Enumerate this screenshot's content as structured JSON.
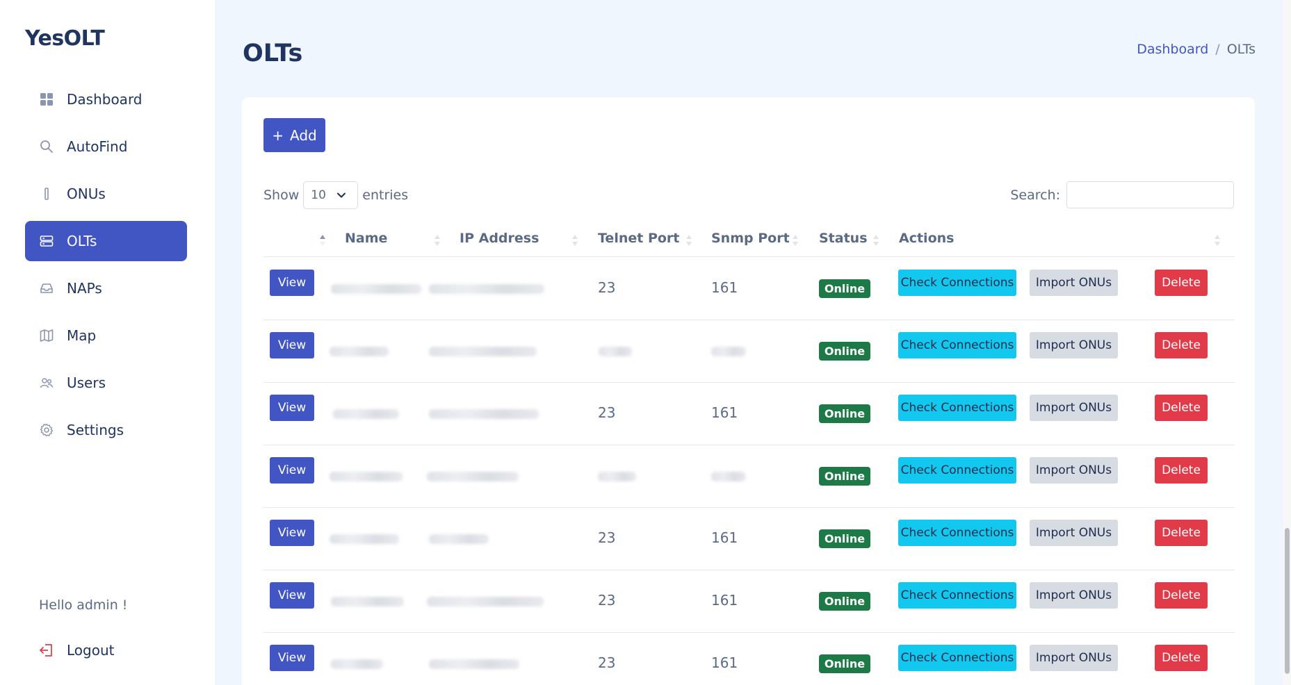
{
  "brand": "YesOLT",
  "nav": [
    {
      "label": "Dashboard",
      "icon": "grid-icon",
      "active": false
    },
    {
      "label": "AutoFind",
      "icon": "search-icon",
      "active": false
    },
    {
      "label": "ONUs",
      "icon": "device-icon",
      "active": false
    },
    {
      "label": "OLTs",
      "icon": "server-icon",
      "active": true
    },
    {
      "label": "NAPs",
      "icon": "inbox-icon",
      "active": false
    },
    {
      "label": "Map",
      "icon": "map-icon",
      "active": false
    },
    {
      "label": "Users",
      "icon": "users-icon",
      "active": false
    },
    {
      "label": "Settings",
      "icon": "gear-icon",
      "active": false
    }
  ],
  "greeting": "Hello admin !",
  "logout_label": "Logout",
  "page_title": "OLTs",
  "breadcrumb": {
    "home": "Dashboard",
    "separator": "/",
    "current": "OLTs"
  },
  "add_label": "Add",
  "length": {
    "prefix": "Show",
    "value": "10",
    "suffix": "entries"
  },
  "search_label": "Search:",
  "columns": [
    "Name",
    "IP Address",
    "Telnet Port",
    "Snmp Port",
    "Status",
    "Actions"
  ],
  "actions": {
    "view": "View",
    "check": "Check Connections",
    "import": "Import ONUs",
    "delete": "Delete"
  },
  "rows": [
    {
      "telnet": "23",
      "snmp": "161",
      "status": "Online"
    },
    {
      "telnet": "",
      "snmp": "",
      "status": "Online"
    },
    {
      "telnet": "23",
      "snmp": "161",
      "status": "Online"
    },
    {
      "telnet": "",
      "snmp": "",
      "status": "Online"
    },
    {
      "telnet": "23",
      "snmp": "161",
      "status": "Online"
    },
    {
      "telnet": "23",
      "snmp": "161",
      "status": "Online"
    },
    {
      "telnet": "23",
      "snmp": "161",
      "status": "Online"
    }
  ],
  "colors": {
    "primary": "#4256c3",
    "info": "#13c8ef",
    "danger": "#e13a48",
    "success": "#1d7a47",
    "secondary": "#d7dbe2"
  }
}
